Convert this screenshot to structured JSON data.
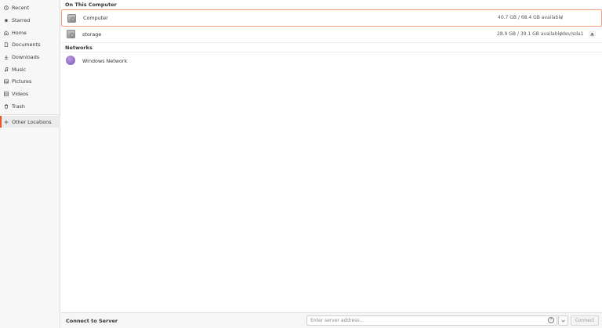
{
  "sidebar": {
    "items": [
      {
        "label": "Recent",
        "icon": "clock-icon"
      },
      {
        "label": "Starred",
        "icon": "star-icon"
      },
      {
        "label": "Home",
        "icon": "home-icon"
      },
      {
        "label": "Documents",
        "icon": "document-icon"
      },
      {
        "label": "Downloads",
        "icon": "download-icon"
      },
      {
        "label": "Music",
        "icon": "music-icon"
      },
      {
        "label": "Pictures",
        "icon": "picture-icon"
      },
      {
        "label": "Videos",
        "icon": "video-icon"
      },
      {
        "label": "Trash",
        "icon": "trash-icon"
      }
    ],
    "other_locations": {
      "label": "Other Locations",
      "icon": "plus-icon",
      "active": true
    }
  },
  "on_this_computer": {
    "title": "On This Computer",
    "drives": [
      {
        "name": "Computer",
        "usage": "40.7 GB / 68.4 GB available",
        "mount": "/",
        "selected": true
      },
      {
        "name": "storage",
        "usage": "28.9 GB / 39.1 GB available",
        "mount": "/dev/sda1",
        "eject": true
      }
    ]
  },
  "networks": {
    "title": "Networks",
    "items": [
      {
        "name": "Windows Network",
        "icon": "network-icon"
      }
    ]
  },
  "connect_bar": {
    "label": "Connect to Server",
    "placeholder": "Enter server address...",
    "help_glyph": "?",
    "connect_label": "Connect"
  },
  "colors": {
    "accent": "#e95420",
    "selection_border": "#f0a07a"
  }
}
